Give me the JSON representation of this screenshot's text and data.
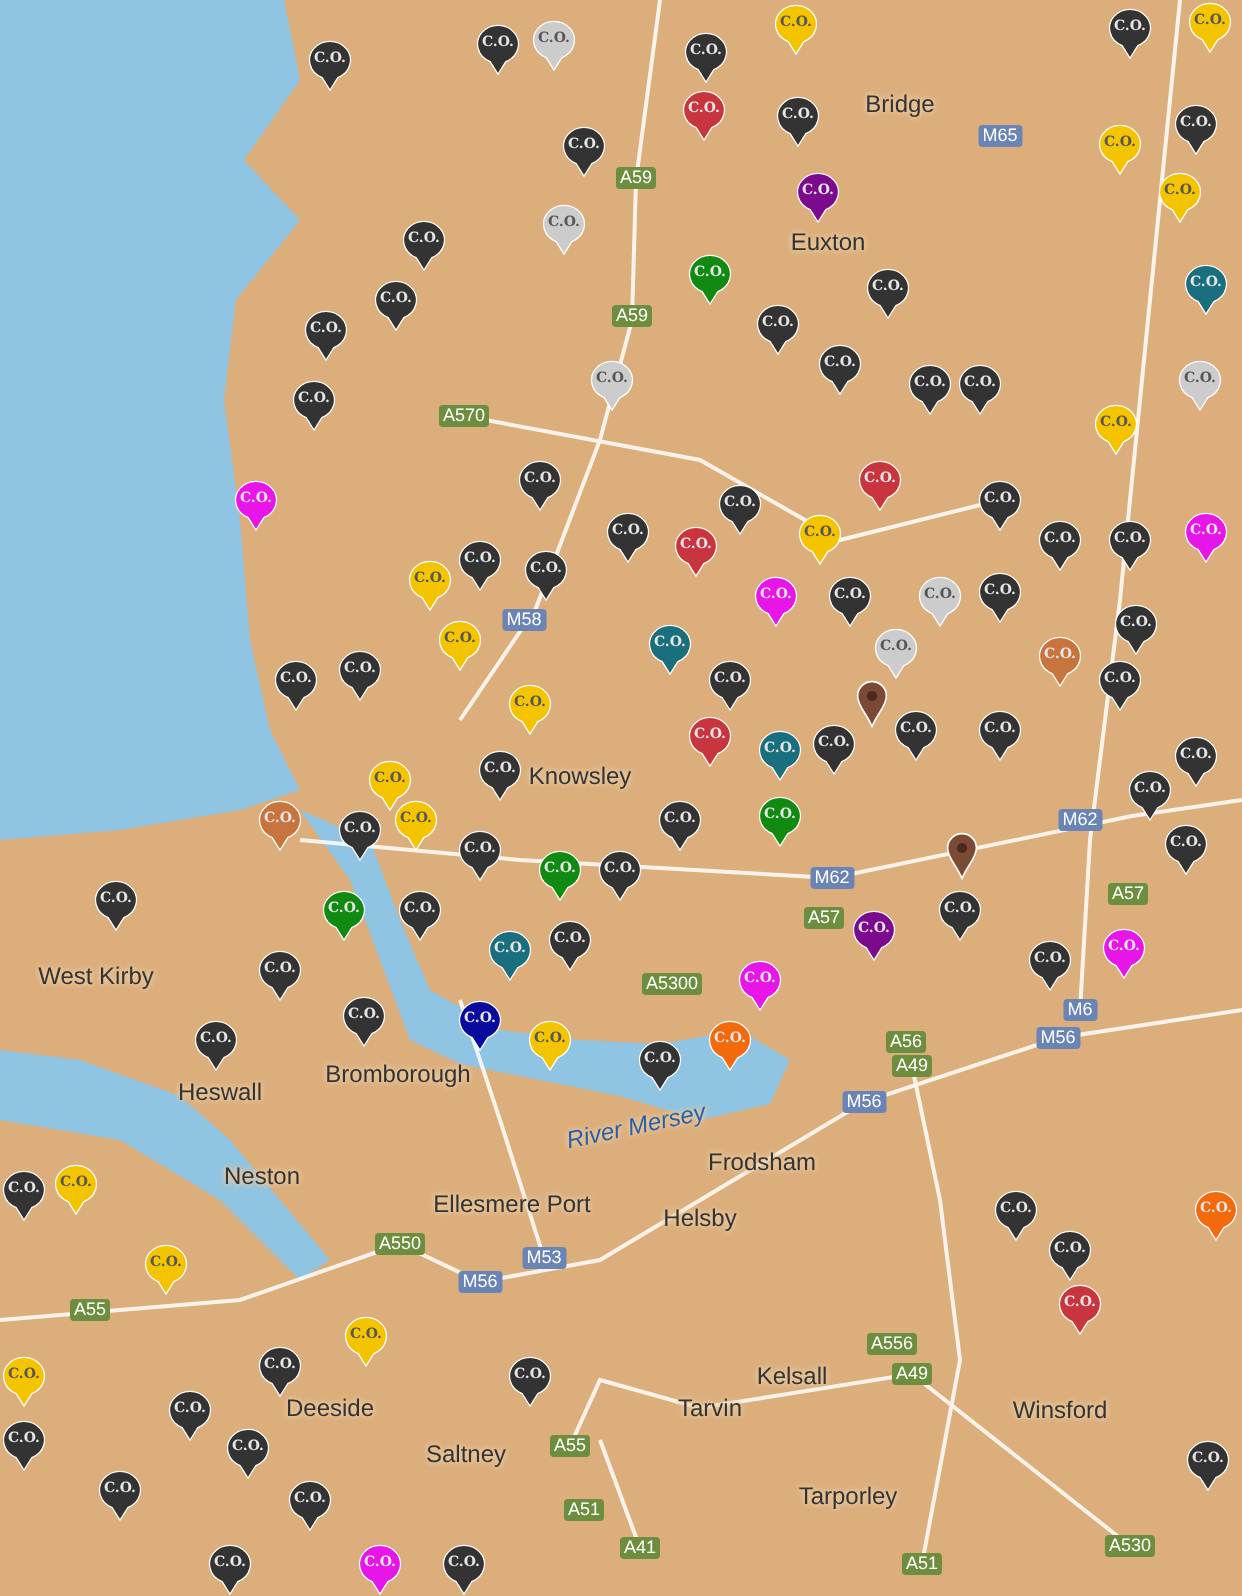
{
  "places": [
    {
      "name": "Bridge"
    },
    {
      "name": "Euxton"
    },
    {
      "name": "Knowsley"
    },
    {
      "name": "West Kirby"
    },
    {
      "name": "Heswall"
    },
    {
      "name": "Bromborough"
    },
    {
      "name": "River Mersey",
      "kind": "water"
    },
    {
      "name": "Neston"
    },
    {
      "name": "Ellesmere Port"
    },
    {
      "name": "Helsby"
    },
    {
      "name": "Frodsham"
    },
    {
      "name": "Deeside"
    },
    {
      "name": "Saltney"
    },
    {
      "name": "Tarvin"
    },
    {
      "name": "Kelsall"
    },
    {
      "name": "Tarporley"
    },
    {
      "name": "Winsford"
    }
  ],
  "roads": [
    {
      "label": "M65",
      "kind": "motorway"
    },
    {
      "label": "A59",
      "kind": "a-road"
    },
    {
      "label": "A59",
      "kind": "a-road"
    },
    {
      "label": "A570",
      "kind": "a-road"
    },
    {
      "label": "M58",
      "kind": "motorway"
    },
    {
      "label": "M62",
      "kind": "motorway"
    },
    {
      "label": "M62",
      "kind": "motorway"
    },
    {
      "label": "A57",
      "kind": "a-road"
    },
    {
      "label": "A57",
      "kind": "a-road"
    },
    {
      "label": "A5300",
      "kind": "a-road"
    },
    {
      "label": "A56",
      "kind": "a-road"
    },
    {
      "label": "M56",
      "kind": "motorway"
    },
    {
      "label": "M6",
      "kind": "motorway"
    },
    {
      "label": "M56",
      "kind": "motorway"
    },
    {
      "label": "A49",
      "kind": "a-road"
    },
    {
      "label": "A550",
      "kind": "a-road"
    },
    {
      "label": "M56",
      "kind": "motorway"
    },
    {
      "label": "M53",
      "kind": "motorway"
    },
    {
      "label": "A55",
      "kind": "a-road"
    },
    {
      "label": "A556",
      "kind": "a-road"
    },
    {
      "label": "A49",
      "kind": "a-road"
    },
    {
      "label": "A51",
      "kind": "a-road"
    },
    {
      "label": "A55",
      "kind": "a-road"
    },
    {
      "label": "A41",
      "kind": "a-road"
    },
    {
      "label": "A530",
      "kind": "a-road"
    },
    {
      "label": "A51",
      "kind": "a-road"
    }
  ],
  "markers": [
    {
      "kind": "location"
    },
    {
      "kind": "location"
    }
  ],
  "pins": [
    {
      "label": "C.O.",
      "color": "#333333"
    },
    {
      "label": "C.O.",
      "color": "#333333"
    },
    {
      "label": "C.O.",
      "color": "#cccccc"
    },
    {
      "label": "C.O.",
      "color": "#333333"
    },
    {
      "label": "C.O.",
      "color": "#f5c400"
    },
    {
      "label": "C.O.",
      "color": "#333333"
    },
    {
      "label": "C.O.",
      "color": "#f5c400"
    },
    {
      "label": "C.O.",
      "color": "#c9353f"
    },
    {
      "label": "C.O.",
      "color": "#333333"
    },
    {
      "label": "C.O.",
      "color": "#7c0a8c"
    },
    {
      "label": "C.O.",
      "color": "#f5c400"
    },
    {
      "label": "C.O.",
      "color": "#333333"
    },
    {
      "label": "C.O.",
      "color": "#f5c400"
    },
    {
      "label": "C.O.",
      "color": "#333333"
    },
    {
      "label": "C.O.",
      "color": "#cccccc"
    },
    {
      "label": "C.O.",
      "color": "#118a11"
    },
    {
      "label": "C.O.",
      "color": "#333333"
    },
    {
      "label": "C.O.",
      "color": "#333333"
    },
    {
      "label": "C.O.",
      "color": "#333333"
    },
    {
      "label": "C.O.",
      "color": "#1a6f7e"
    },
    {
      "label": "C.O.",
      "color": "#333333"
    },
    {
      "label": "C.O.",
      "color": "#333333"
    },
    {
      "label": "C.O.",
      "color": "#333333"
    },
    {
      "label": "C.O.",
      "color": "#cccccc"
    },
    {
      "label": "C.O.",
      "color": "#333333"
    },
    {
      "label": "C.O.",
      "color": "#333333"
    },
    {
      "label": "C.O.",
      "color": "#333333"
    },
    {
      "label": "C.O.",
      "color": "#f5c400"
    },
    {
      "label": "C.O.",
      "color": "#cccccc"
    },
    {
      "label": "C.O.",
      "color": "#e815e8"
    },
    {
      "label": "C.O.",
      "color": "#333333"
    },
    {
      "label": "C.O.",
      "color": "#333333"
    },
    {
      "label": "C.O.",
      "color": "#c9353f"
    },
    {
      "label": "C.O.",
      "color": "#f5c400"
    },
    {
      "label": "C.O.",
      "color": "#c9353f"
    },
    {
      "label": "C.O.",
      "color": "#333333"
    },
    {
      "label": "C.O.",
      "color": "#333333"
    },
    {
      "label": "C.O.",
      "color": "#e815e8"
    },
    {
      "label": "C.O.",
      "color": "#333333"
    },
    {
      "label": "C.O.",
      "color": "#333333"
    },
    {
      "label": "C.O.",
      "color": "#f5c400"
    },
    {
      "label": "C.O.",
      "color": "#333333"
    },
    {
      "label": "C.O.",
      "color": "#f5c400"
    },
    {
      "label": "C.O.",
      "color": "#333333"
    },
    {
      "label": "C.O.",
      "color": "#e815e8"
    },
    {
      "label": "C.O.",
      "color": "#333333"
    },
    {
      "label": "C.O.",
      "color": "#cccccc"
    },
    {
      "label": "C.O.",
      "color": "#333333"
    },
    {
      "label": "C.O.",
      "color": "#333333"
    },
    {
      "label": "C.O.",
      "color": "#333333"
    },
    {
      "label": "C.O.",
      "color": "#333333"
    },
    {
      "label": "C.O.",
      "color": "#1a6f7e"
    },
    {
      "label": "C.O.",
      "color": "#cccccc"
    },
    {
      "label": "C.O.",
      "color": "#333333"
    },
    {
      "label": "C.O.",
      "color": "#333333"
    },
    {
      "label": "C.O.",
      "color": "#c8743f"
    },
    {
      "label": "C.O.",
      "color": "#333333"
    },
    {
      "label": "C.O.",
      "color": "#333333"
    },
    {
      "label": "C.O.",
      "color": "#f5c400"
    },
    {
      "label": "C.O.",
      "color": "#333333"
    },
    {
      "label": "C.O.",
      "color": "#333333"
    },
    {
      "label": "C.O.",
      "color": "#f5c400"
    },
    {
      "label": "C.O.",
      "color": "#c9353f"
    },
    {
      "label": "C.O.",
      "color": "#1a6f7e"
    },
    {
      "label": "C.O.",
      "color": "#333333"
    },
    {
      "label": "C.O.",
      "color": "#333333"
    },
    {
      "label": "C.O.",
      "color": "#118a11"
    },
    {
      "label": "C.O.",
      "color": "#333333"
    },
    {
      "label": "C.O.",
      "color": "#c8743f"
    },
    {
      "label": "C.O.",
      "color": "#333333"
    },
    {
      "label": "C.O.",
      "color": "#333333"
    },
    {
      "label": "C.O.",
      "color": "#f5c400"
    },
    {
      "label": "C.O.",
      "color": "#333333"
    },
    {
      "label": "C.O.",
      "color": "#118a11"
    },
    {
      "label": "C.O.",
      "color": "#333333"
    },
    {
      "label": "C.O.",
      "color": "#118a11"
    },
    {
      "label": "C.O.",
      "color": "#333333"
    },
    {
      "label": "C.O.",
      "color": "#333333"
    },
    {
      "label": "C.O.",
      "color": "#333333"
    },
    {
      "label": "C.O.",
      "color": "#1a6f7e"
    },
    {
      "label": "C.O.",
      "color": "#333333"
    },
    {
      "label": "C.O.",
      "color": "#0a0a9c"
    },
    {
      "label": "C.O.",
      "color": "#f5c400"
    },
    {
      "label": "C.O.",
      "color": "#333333"
    },
    {
      "label": "C.O.",
      "color": "#333333"
    },
    {
      "label": "C.O.",
      "color": "#e815e8"
    },
    {
      "label": "C.O.",
      "color": "#f26a0b"
    },
    {
      "label": "C.O.",
      "color": "#7c0a8c"
    },
    {
      "label": "C.O.",
      "color": "#333333"
    },
    {
      "label": "C.O.",
      "color": "#333333"
    },
    {
      "label": "C.O.",
      "color": "#e815e8"
    },
    {
      "label": "C.O.",
      "color": "#333333"
    },
    {
      "label": "C.O.",
      "color": "#f5c400"
    },
    {
      "label": "C.O.",
      "color": "#333333"
    },
    {
      "label": "C.O.",
      "color": "#f5c400"
    },
    {
      "label": "C.O.",
      "color": "#f5c400"
    },
    {
      "label": "C.O.",
      "color": "#333333"
    },
    {
      "label": "C.O.",
      "color": "#f5c400"
    },
    {
      "label": "C.O.",
      "color": "#333333"
    },
    {
      "label": "C.O.",
      "color": "#333333"
    },
    {
      "label": "C.O.",
      "color": "#333333"
    },
    {
      "label": "C.O.",
      "color": "#333333"
    },
    {
      "label": "C.O.",
      "color": "#333333"
    },
    {
      "label": "C.O.",
      "color": "#333333"
    },
    {
      "label": "C.O.",
      "color": "#333333"
    },
    {
      "label": "C.O.",
      "color": "#e815e8"
    },
    {
      "label": "C.O.",
      "color": "#333333"
    },
    {
      "label": "C.O.",
      "color": "#333333"
    },
    {
      "label": "C.O.",
      "color": "#c9353f"
    },
    {
      "label": "C.O.",
      "color": "#f26a0b"
    },
    {
      "label": "C.O.",
      "color": "#333333"
    },
    {
      "label": "C.O.",
      "color": "#333333"
    }
  ]
}
